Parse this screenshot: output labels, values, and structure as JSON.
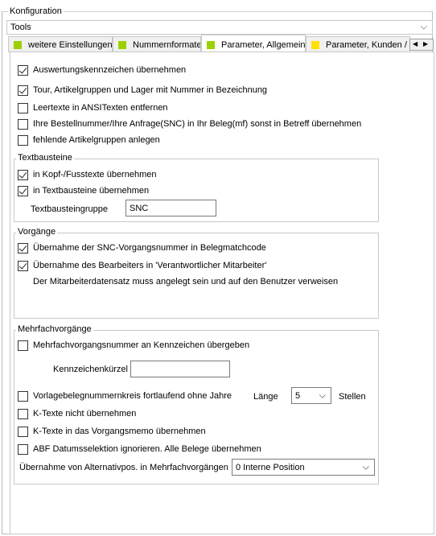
{
  "group_title": "Konfiguration",
  "tools_combo": {
    "value": "Tools",
    "arrow": "⌵"
  },
  "tabs": [
    {
      "label": "weitere Einstellungen",
      "color": "#9bd100"
    },
    {
      "label": "Nummernformate",
      "color": "#9bd100"
    },
    {
      "label": "Parameter, Allgemein",
      "color": "#9bd100"
    },
    {
      "label": "Parameter, Kunden / L",
      "color": "#ffe000"
    }
  ],
  "tab_scroll": {
    "left": "◀",
    "right": "▶"
  },
  "general_options": [
    {
      "label": "Auswertungskennzeichen übernehmen",
      "checked": true
    },
    {
      "label": "Tour, Artikelgruppen und Lager mit Nummer in Bezeichnung",
      "checked": true
    },
    {
      "label": "Leertexte in ANSITexten entfernen",
      "checked": false
    },
    {
      "label": "Ihre Bestellnummer/Ihre Anfrage(SNC) in Ihr Beleg(mf) sonst in Betreff übernehmen",
      "checked": false
    },
    {
      "label": "fehlende Artikelgruppen anlegen",
      "checked": false
    }
  ],
  "textbausteine": {
    "title": "Textbausteine",
    "options": [
      {
        "label": "in Kopf-/Fusstexte übernehmen",
        "checked": true
      },
      {
        "label": "in Textbausteine übernehmen",
        "checked": true
      }
    ],
    "group_label": "Textbausteingruppe",
    "group_value": "SNC"
  },
  "vorgaenge": {
    "title": "Vorgänge",
    "options": [
      {
        "label": "Übernahme der SNC-Vorgangsnummer in Belegmatchcode",
        "checked": true
      },
      {
        "label": "Übernahme des Bearbeiters in 'Verantwortlicher Mitarbeiter'",
        "checked": true
      }
    ],
    "note": "Der Mitarbeiterdatensatz muss angelegt sein und auf den Benutzer verweisen"
  },
  "mehrfach": {
    "title": "Mehrfachvorgänge",
    "opt_pass": {
      "label": "Mehrfachvorgangsnummer an Kennzeichen übergeben",
      "checked": false
    },
    "kurz_label": "Kennzeichenkürzel",
    "kurz_value": "",
    "opt_vorlage": {
      "label": "Vorlagebelegnummernkreis fortlaufend ohne Jahre",
      "checked": false
    },
    "laenge_label": "Länge",
    "laenge_value": "5",
    "stellen_label": "Stellen",
    "opt_ktexte": {
      "label": "K-Texte nicht übernehmen",
      "checked": false
    },
    "opt_memo": {
      "label": "K-Texte in das Vorgangsmemo übernehmen",
      "checked": false
    },
    "opt_abf": {
      "label": "ABF Datumsselektion ignorieren. Alle Belege übernehmen",
      "checked": false
    },
    "alt_label": "Übernahme von Alternativpos. in Mehrfachvorgängen",
    "alt_value": "0 Interne Position"
  }
}
